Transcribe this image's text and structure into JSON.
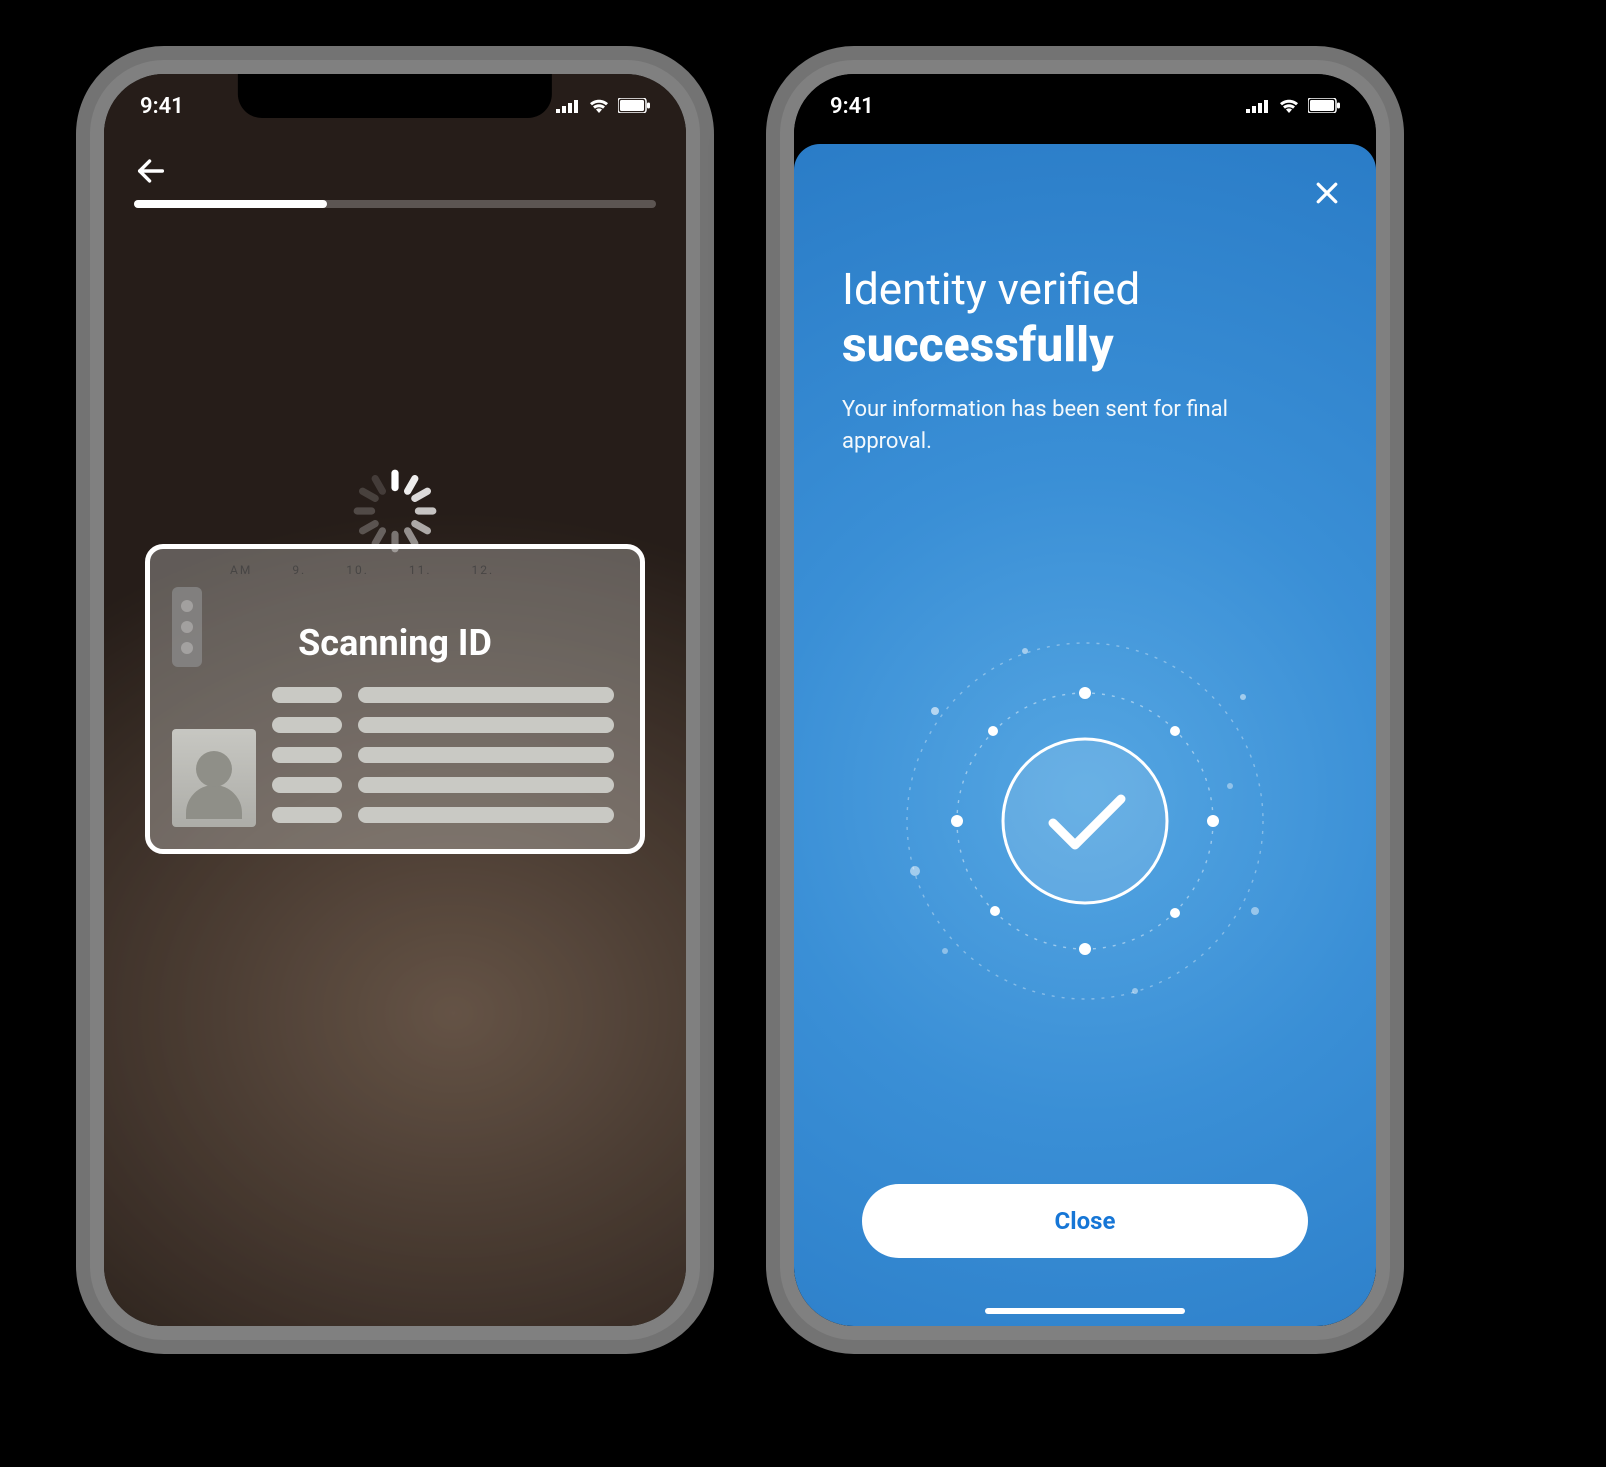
{
  "status": {
    "time": "9:41"
  },
  "scan": {
    "label": "Scanning ID",
    "progress_percent": 37
  },
  "success": {
    "title_line1": "Identity verified",
    "title_line2": "successfully",
    "subtitle": "Your information has been sent for final approval.",
    "close_label": "Close"
  },
  "colors": {
    "accent_blue": "#2a7cc7",
    "button_text": "#1676d6"
  }
}
